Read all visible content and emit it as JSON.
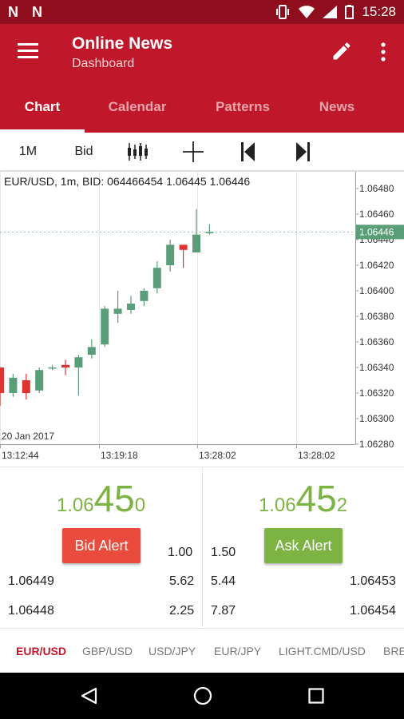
{
  "status_bar": {
    "left_icons": "N N",
    "time": "15:28"
  },
  "app_bar": {
    "title": "Online News",
    "subtitle": "Dashboard"
  },
  "tabs": [
    {
      "label": "Chart",
      "active": true
    },
    {
      "label": "Calendar",
      "active": false
    },
    {
      "label": "Patterns",
      "active": false
    },
    {
      "label": "News",
      "active": false
    }
  ],
  "toolbar": {
    "timeframe": "1M",
    "price_type": "Bid"
  },
  "chart": {
    "ohlc_line": "EUR/USD, 1m, BID:    064466454 1.06445 1.06446",
    "date_label": "20 Jan 2017",
    "current_price_label": "1.06446"
  },
  "chart_data": {
    "type": "candlestick",
    "symbol": "EUR/USD",
    "timeframe": "1m",
    "y_ticks": [
      "1.06480",
      "1.06460",
      "1.06440",
      "1.06420",
      "1.06400",
      "1.06380",
      "1.06360",
      "1.06340",
      "1.06320",
      "1.06300",
      "1.06280"
    ],
    "ylim": [
      1.0628,
      1.0648
    ],
    "x_ticks": [
      "13:12:44",
      "13:19:18",
      "13:28:02",
      "13:28:02"
    ],
    "current_price": 1.06446,
    "candles": [
      {
        "o": 1.0634,
        "h": 1.0634,
        "l": 1.0631,
        "c": 1.0632
      },
      {
        "o": 1.0632,
        "h": 1.06335,
        "l": 1.06317,
        "c": 1.06332
      },
      {
        "o": 1.0633,
        "h": 1.06335,
        "l": 1.06315,
        "c": 1.0632
      },
      {
        "o": 1.06322,
        "h": 1.0634,
        "l": 1.0632,
        "c": 1.06338
      },
      {
        "o": 1.0634,
        "h": 1.06342,
        "l": 1.06338,
        "c": 1.0634
      },
      {
        "o": 1.06342,
        "h": 1.06346,
        "l": 1.06334,
        "c": 1.0634
      },
      {
        "o": 1.0634,
        "h": 1.0635,
        "l": 1.06318,
        "c": 1.06348
      },
      {
        "o": 1.0635,
        "h": 1.06362,
        "l": 1.06347,
        "c": 1.06356
      },
      {
        "o": 1.06358,
        "h": 1.06388,
        "l": 1.06356,
        "c": 1.06386
      },
      {
        "o": 1.06382,
        "h": 1.064,
        "l": 1.06375,
        "c": 1.06386
      },
      {
        "o": 1.06385,
        "h": 1.06396,
        "l": 1.06382,
        "c": 1.0639
      },
      {
        "o": 1.06392,
        "h": 1.06402,
        "l": 1.06388,
        "c": 1.064
      },
      {
        "o": 1.06402,
        "h": 1.06423,
        "l": 1.06398,
        "c": 1.06418
      },
      {
        "o": 1.0642,
        "h": 1.0644,
        "l": 1.06415,
        "c": 1.06436
      },
      {
        "o": 1.06436,
        "h": 1.06436,
        "l": 1.06418,
        "c": 1.06432
      },
      {
        "o": 1.0643,
        "h": 1.06464,
        "l": 1.0643,
        "c": 1.06444
      },
      {
        "o": 1.06446,
        "h": 1.06452,
        "l": 1.06444,
        "c": 1.06446
      }
    ]
  },
  "quotes": {
    "bid": {
      "prefix": "1.06",
      "big": "45",
      "suffix": "0",
      "alert_label": "Bid Alert",
      "color": "#e94b3c"
    },
    "ask": {
      "prefix": "1.06",
      "big": "45",
      "suffix": "2",
      "alert_label": "Ask Alert",
      "color": "#7cb342"
    },
    "bid_volume_top": "1.00",
    "ask_volume_top": "1.50",
    "rows": [
      {
        "bid_price": "1.06449",
        "bid_volume": "5.62",
        "ask_volume": "5.44",
        "ask_price": "1.06453"
      },
      {
        "bid_price": "1.06448",
        "bid_volume": "2.25",
        "ask_volume": "7.87",
        "ask_price": "1.06454"
      }
    ]
  },
  "symbols": [
    "EUR/USD",
    "GBP/USD",
    "USD/JPY",
    "EUR/JPY",
    "LIGHT.CMD/USD",
    "BRE"
  ],
  "colors": {
    "brand": "#c0172a",
    "status_bar": "#8e0e1e",
    "up": "#5a9e79",
    "down": "#e0322f"
  }
}
